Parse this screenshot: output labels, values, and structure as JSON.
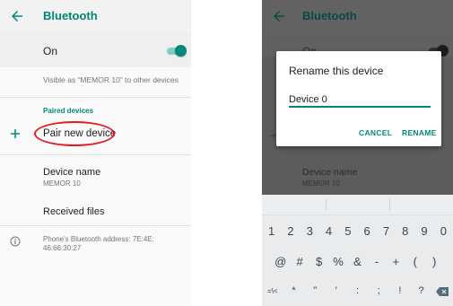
{
  "left": {
    "title": "Bluetooth",
    "on_label": "On",
    "visible_text": "Visible as “MEMOR 10” to other devices",
    "paired_header": "Paired devices",
    "pair_new": "Pair new device",
    "device_name_label": "Device name",
    "device_name_value": "MEMOR 10",
    "received_files": "Received files",
    "address_text": "Phone's Bluetooth address: 7E:4E: 46:66:30:27",
    "toggle_on": true,
    "accent_color": "#00897b",
    "highlight_color": "#e31b23"
  },
  "right": {
    "title": "Bluetooth",
    "on_label": "On",
    "device_name_label": "Device name",
    "device_name_value": "MEMOR 10",
    "dialog": {
      "title": "Rename this device",
      "input_value": "Device 0",
      "cancel": "CANCEL",
      "rename": "RENAME"
    },
    "keyboard": {
      "row1": [
        "1",
        "2",
        "3",
        "4",
        "5",
        "6",
        "7",
        "8",
        "9",
        "0"
      ],
      "row2": [
        "@",
        "#",
        "$",
        "%",
        "&",
        "-",
        "+",
        "(",
        ")"
      ],
      "row3": [
        "=\\<",
        "*",
        "\"",
        "'",
        ":",
        ";",
        "!",
        "?"
      ]
    }
  },
  "icons": [
    "back-arrow-icon",
    "plus-icon",
    "info-icon",
    "backspace-icon"
  ]
}
